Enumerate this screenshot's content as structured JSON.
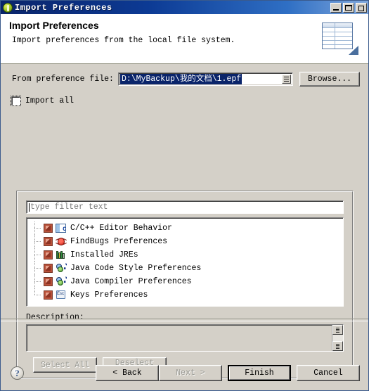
{
  "window": {
    "title": "Import Preferences",
    "icon": "eclipse-ball-icon",
    "controls": {
      "minimize": "minimize-button",
      "maximize": "maximize-button",
      "close": "close-button"
    }
  },
  "banner": {
    "title": "Import Preferences",
    "subtitle": "Import preferences from the local file system.",
    "icon": "preferences-sheet-icon"
  },
  "file_row": {
    "label": "From preference file:",
    "value": "D:\\MyBackup\\我的文档\\1.epf",
    "browse_label": "Browse...",
    "dropdown_icon": "combo-dropdown-icon"
  },
  "import_all": {
    "label": "Import all",
    "checked": false
  },
  "group": {
    "filter_placeholder": "type filter text",
    "tree_items": [
      {
        "label": "C/C++ Editor Behavior",
        "icon": "cpp-editor-icon",
        "checked": false
      },
      {
        "label": "FindBugs Preferences",
        "icon": "findbugs-icon",
        "checked": false
      },
      {
        "label": "Installed JREs",
        "icon": "jre-books-icon",
        "checked": false
      },
      {
        "label": "Java Code Style Preferences",
        "icon": "java-icon",
        "checked": false
      },
      {
        "label": "Java Compiler Preferences",
        "icon": "java-icon",
        "checked": false
      },
      {
        "label": "Keys Preferences",
        "icon": "keys-icon",
        "checked": false
      }
    ],
    "description_label": "Description:",
    "description_value": "",
    "select_all_label": "Select All",
    "deselect_all_label": "Deselect All"
  },
  "footer": {
    "help_label": "?",
    "back_label": "< Back",
    "next_label": "Next >",
    "finish_label": "Finish",
    "cancel_label": "Cancel"
  },
  "colors": {
    "titlebar_start": "#0a246a",
    "titlebar_end": "#7fa7dc",
    "dialog_bg": "#d4d0c8",
    "selection_bg": "#0a246a",
    "banner_bg": "#ffffff"
  }
}
